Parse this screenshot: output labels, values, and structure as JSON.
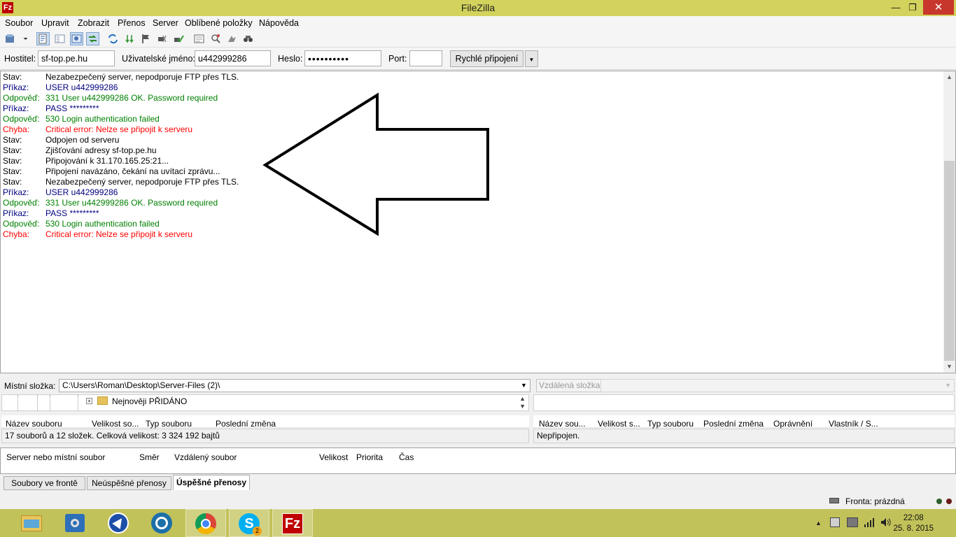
{
  "window": {
    "title": "FileZilla",
    "minimize": "—",
    "maximize": "❐",
    "close": "✕"
  },
  "menu": [
    "Soubor",
    "Upravit",
    "Zobrazit",
    "Přenos",
    "Server",
    "Oblíbené položky",
    "Nápověda"
  ],
  "quickconnect": {
    "host_label": "Hostitel:",
    "host_value": "sf-top.pe.hu",
    "user_label": "Uživatelské jméno:",
    "user_value": "u442999286",
    "pass_label": "Heslo:",
    "pass_value": "••••••••••",
    "port_label": "Port:",
    "port_value": "",
    "connect_label": "Rychlé připojení"
  },
  "log": [
    {
      "type": "Stav:",
      "msg": "Nezabezpečený server, nepodporuje FTP přes TLS.",
      "kind": "status"
    },
    {
      "type": "Příkaz:",
      "msg": "USER u442999286",
      "kind": "cmd"
    },
    {
      "type": "Odpověď:",
      "msg": "331 User u442999286 OK. Password required",
      "kind": "resp"
    },
    {
      "type": "Příkaz:",
      "msg": "PASS *********",
      "kind": "cmd"
    },
    {
      "type": "Odpověď:",
      "msg": "530 Login authentication failed",
      "kind": "resp"
    },
    {
      "type": "Chyba:",
      "msg": "Critical error: Nelze se připojit k serveru",
      "kind": "err"
    },
    {
      "type": "Stav:",
      "msg": "Odpojen od serveru",
      "kind": "status"
    },
    {
      "type": "Stav:",
      "msg": "Zjišťování adresy sf-top.pe.hu",
      "kind": "status"
    },
    {
      "type": "Stav:",
      "msg": "Připojování k 31.170.165.25:21...",
      "kind": "status"
    },
    {
      "type": "Stav:",
      "msg": "Připojení navázáno, čekání na uvítací zprávu...",
      "kind": "status"
    },
    {
      "type": "Stav:",
      "msg": "Nezabezpečený server, nepodporuje FTP přes TLS.",
      "kind": "status"
    },
    {
      "type": "Příkaz:",
      "msg": "USER u442999286",
      "kind": "cmd"
    },
    {
      "type": "Odpověď:",
      "msg": "331 User u442999286 OK. Password required",
      "kind": "resp"
    },
    {
      "type": "Příkaz:",
      "msg": "PASS *********",
      "kind": "cmd"
    },
    {
      "type": "Odpověď:",
      "msg": "530 Login authentication failed",
      "kind": "resp"
    },
    {
      "type": "Chyba:",
      "msg": "Critical error: Nelze se připojit k serveru",
      "kind": "err"
    }
  ],
  "local": {
    "label": "Místní složka:",
    "path": "C:\\Users\\Roman\\Desktop\\Server-Files (2)\\",
    "tree_item": "Nejnověji PŘIDÁNO",
    "columns": [
      "Název souboru",
      "Velikost so...",
      "Typ souboru",
      "Poslední změna"
    ],
    "status": "17 souborů a 12 složek. Celková velikost: 3 324 192 bajtů"
  },
  "remote": {
    "label": "Vzdálená složka:",
    "columns": [
      "Název sou...",
      "Velikost s...",
      "Typ souboru",
      "Poslední změna",
      "Oprávnění",
      "Vlastník / S..."
    ],
    "status": "Nepřipojen."
  },
  "queue": {
    "columns": [
      "Server nebo místní soubor",
      "Směr",
      "Vzdálený soubor",
      "Velikost",
      "Priorita",
      "Čas"
    ],
    "tabs": [
      "Soubory ve frontě",
      "Neúspěšné přenosy",
      "Úspěšné přenosy"
    ]
  },
  "statusbar": {
    "queue_text": "Fronta: prázdná"
  },
  "taskbar": {
    "apps": [
      "file-explorer",
      "control-panel",
      "navigation",
      "speed-dial",
      "chrome",
      "skype",
      "filezilla"
    ],
    "skype_badge": "2",
    "time": "22:08",
    "date": "25. 8. 2015"
  },
  "colors": {
    "title_bar": "#d3d25c",
    "taskbar": "#c2c25a",
    "error": "#ff0000",
    "response": "#008000",
    "command": "#000080"
  }
}
